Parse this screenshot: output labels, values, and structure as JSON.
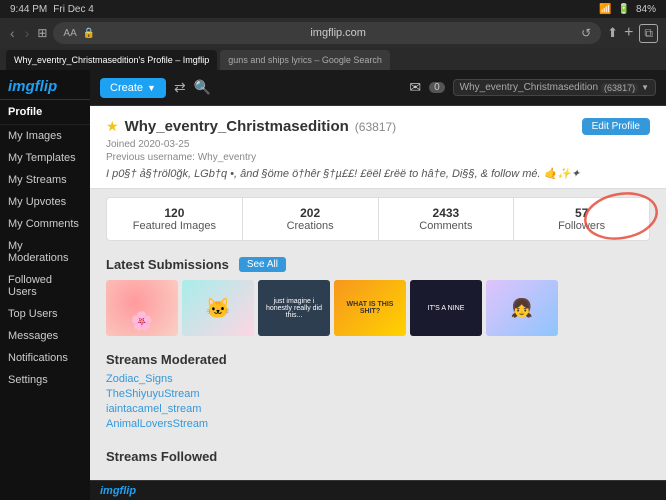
{
  "statusBar": {
    "time": "9:44 PM",
    "date": "Fri Dec 4",
    "wifi": "WiFi",
    "battery": "84%"
  },
  "tabs": [
    {
      "label": "Why_eventry_Christmasedition's Profile – Imgflip",
      "active": true
    },
    {
      "label": "guns and ships lyrics – Google Search",
      "active": false
    }
  ],
  "addressBar": {
    "url": "imgflip.com",
    "aa": "AA"
  },
  "topBar": {
    "createLabel": "Create",
    "notificationCount": "0",
    "username": "Why_eventry_Christmasedition",
    "userId": "63817"
  },
  "sidebar": {
    "logo": "imgflip",
    "items": [
      {
        "label": "Profile",
        "section": true
      },
      {
        "label": "My Images"
      },
      {
        "label": "My Templates"
      },
      {
        "label": "My Streams"
      },
      {
        "label": "My Upvotes"
      },
      {
        "label": "My Comments"
      },
      {
        "label": "My Moderations"
      },
      {
        "label": "Followed Users"
      },
      {
        "label": "Top Users"
      },
      {
        "label": "Messages"
      },
      {
        "label": "Notifications"
      },
      {
        "label": "Settings"
      }
    ]
  },
  "profile": {
    "username": "Why_eventry_Christmasedition",
    "userId": "(63817)",
    "joinDate": "Joined 2020-03-25",
    "previousUsername": "Previous username: Why_eventry",
    "bio": "I p0§† ả§†röl0ğk, LGb†q •, ând §öme ö†hêr §†µ££! £ëël £rëë to hâ†e, Di§§, & follow mé. 🤙✨✦",
    "editLabel": "Edit Profile"
  },
  "stats": [
    {
      "label": "120 Featured Images",
      "number": "120",
      "unit": "Featured Images"
    },
    {
      "label": "202 Creations",
      "number": "202",
      "unit": "Creations"
    },
    {
      "label": "2433 Comments",
      "number": "2433",
      "unit": "Comments"
    },
    {
      "label": "57 Followers",
      "number": "57",
      "unit": "Followers",
      "highlighted": true
    }
  ],
  "submissions": {
    "title": "Latest Submissions",
    "seeAllLabel": "See All",
    "items": [
      {
        "id": 1,
        "alt": "flower image"
      },
      {
        "id": 2,
        "alt": "cat image"
      },
      {
        "id": 3,
        "alt": "anime image",
        "text": "just imagine i honestly really did this..."
      },
      {
        "id": 4,
        "alt": "group image",
        "text": "WHAT IS THIS SHIT?"
      },
      {
        "id": 5,
        "alt": "meme",
        "text": "IT'S A NINE"
      },
      {
        "id": 6,
        "alt": "anime girl"
      }
    ]
  },
  "streamsModerated": {
    "title": "Streams Moderated",
    "streams": [
      "Zodiac_Signs",
      "TheShiyuyuStream",
      "iaintacamel_stream",
      "AnimalLoversStream"
    ]
  },
  "streamsFollowed": {
    "title": "Streams Followed"
  },
  "bottomBar": {
    "logo": "imgflip"
  }
}
